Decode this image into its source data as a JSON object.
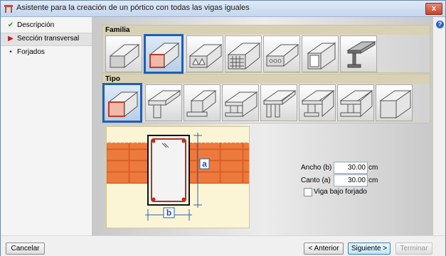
{
  "window": {
    "title": "Asistente para la creación de un pórtico con todas las vigas iguales",
    "close_label": "x"
  },
  "sidebar": {
    "items": [
      {
        "label": "Descripción",
        "mark": "✔",
        "mark_color": "#2e9a2e",
        "state": "done"
      },
      {
        "label": "Sección transversal",
        "mark": "▶",
        "mark_color": "#b02020",
        "state": "active"
      },
      {
        "label": "Forjados",
        "mark": "•",
        "mark_color": "#333333",
        "state": "pending"
      }
    ]
  },
  "help_icon": "?",
  "familia": {
    "header": "Familia",
    "tiles": [
      {
        "icon": "rect-beam-icon",
        "selected": false
      },
      {
        "icon": "rect-hollow-red-icon",
        "selected": true
      },
      {
        "icon": "triangular-voids-beam-icon",
        "selected": false
      },
      {
        "icon": "grid-voids-beam-icon",
        "selected": false
      },
      {
        "icon": "circular-voids-beam-icon",
        "selected": false
      },
      {
        "icon": "hollow-box-beam-icon",
        "selected": false
      },
      {
        "icon": "i-beam-icon",
        "selected": false
      }
    ]
  },
  "tipo": {
    "header": "Tipo",
    "tiles": [
      {
        "icon": "rect-section-icon",
        "selected": true
      },
      {
        "icon": "t-section-icon",
        "selected": false
      },
      {
        "icon": "inverted-t-section-icon",
        "selected": false
      },
      {
        "icon": "cross-section-icon",
        "selected": false
      },
      {
        "icon": "double-t-section-icon",
        "selected": false
      },
      {
        "icon": "wide-flange-section-icon",
        "selected": false
      },
      {
        "icon": "i-section-icon",
        "selected": false
      },
      {
        "icon": "open-section-icon",
        "selected": false
      }
    ]
  },
  "diagram": {
    "width_label": "b",
    "height_label": "a",
    "brick_color": "#e8622a",
    "rebar_color": "#b5321b"
  },
  "dimensions": {
    "ancho": {
      "label": "Ancho (b)",
      "value": "30.00",
      "unit": "cm"
    },
    "canto": {
      "label": "Canto (a)",
      "value": "30.00",
      "unit": "cm"
    },
    "viga_bajo_forjado": {
      "label": "Viga bajo forjado",
      "checked": false
    }
  },
  "buttons": {
    "cancel": "Cancelar",
    "back": "< Anterior",
    "next": "Siguiente >",
    "finish": "Terminar"
  }
}
